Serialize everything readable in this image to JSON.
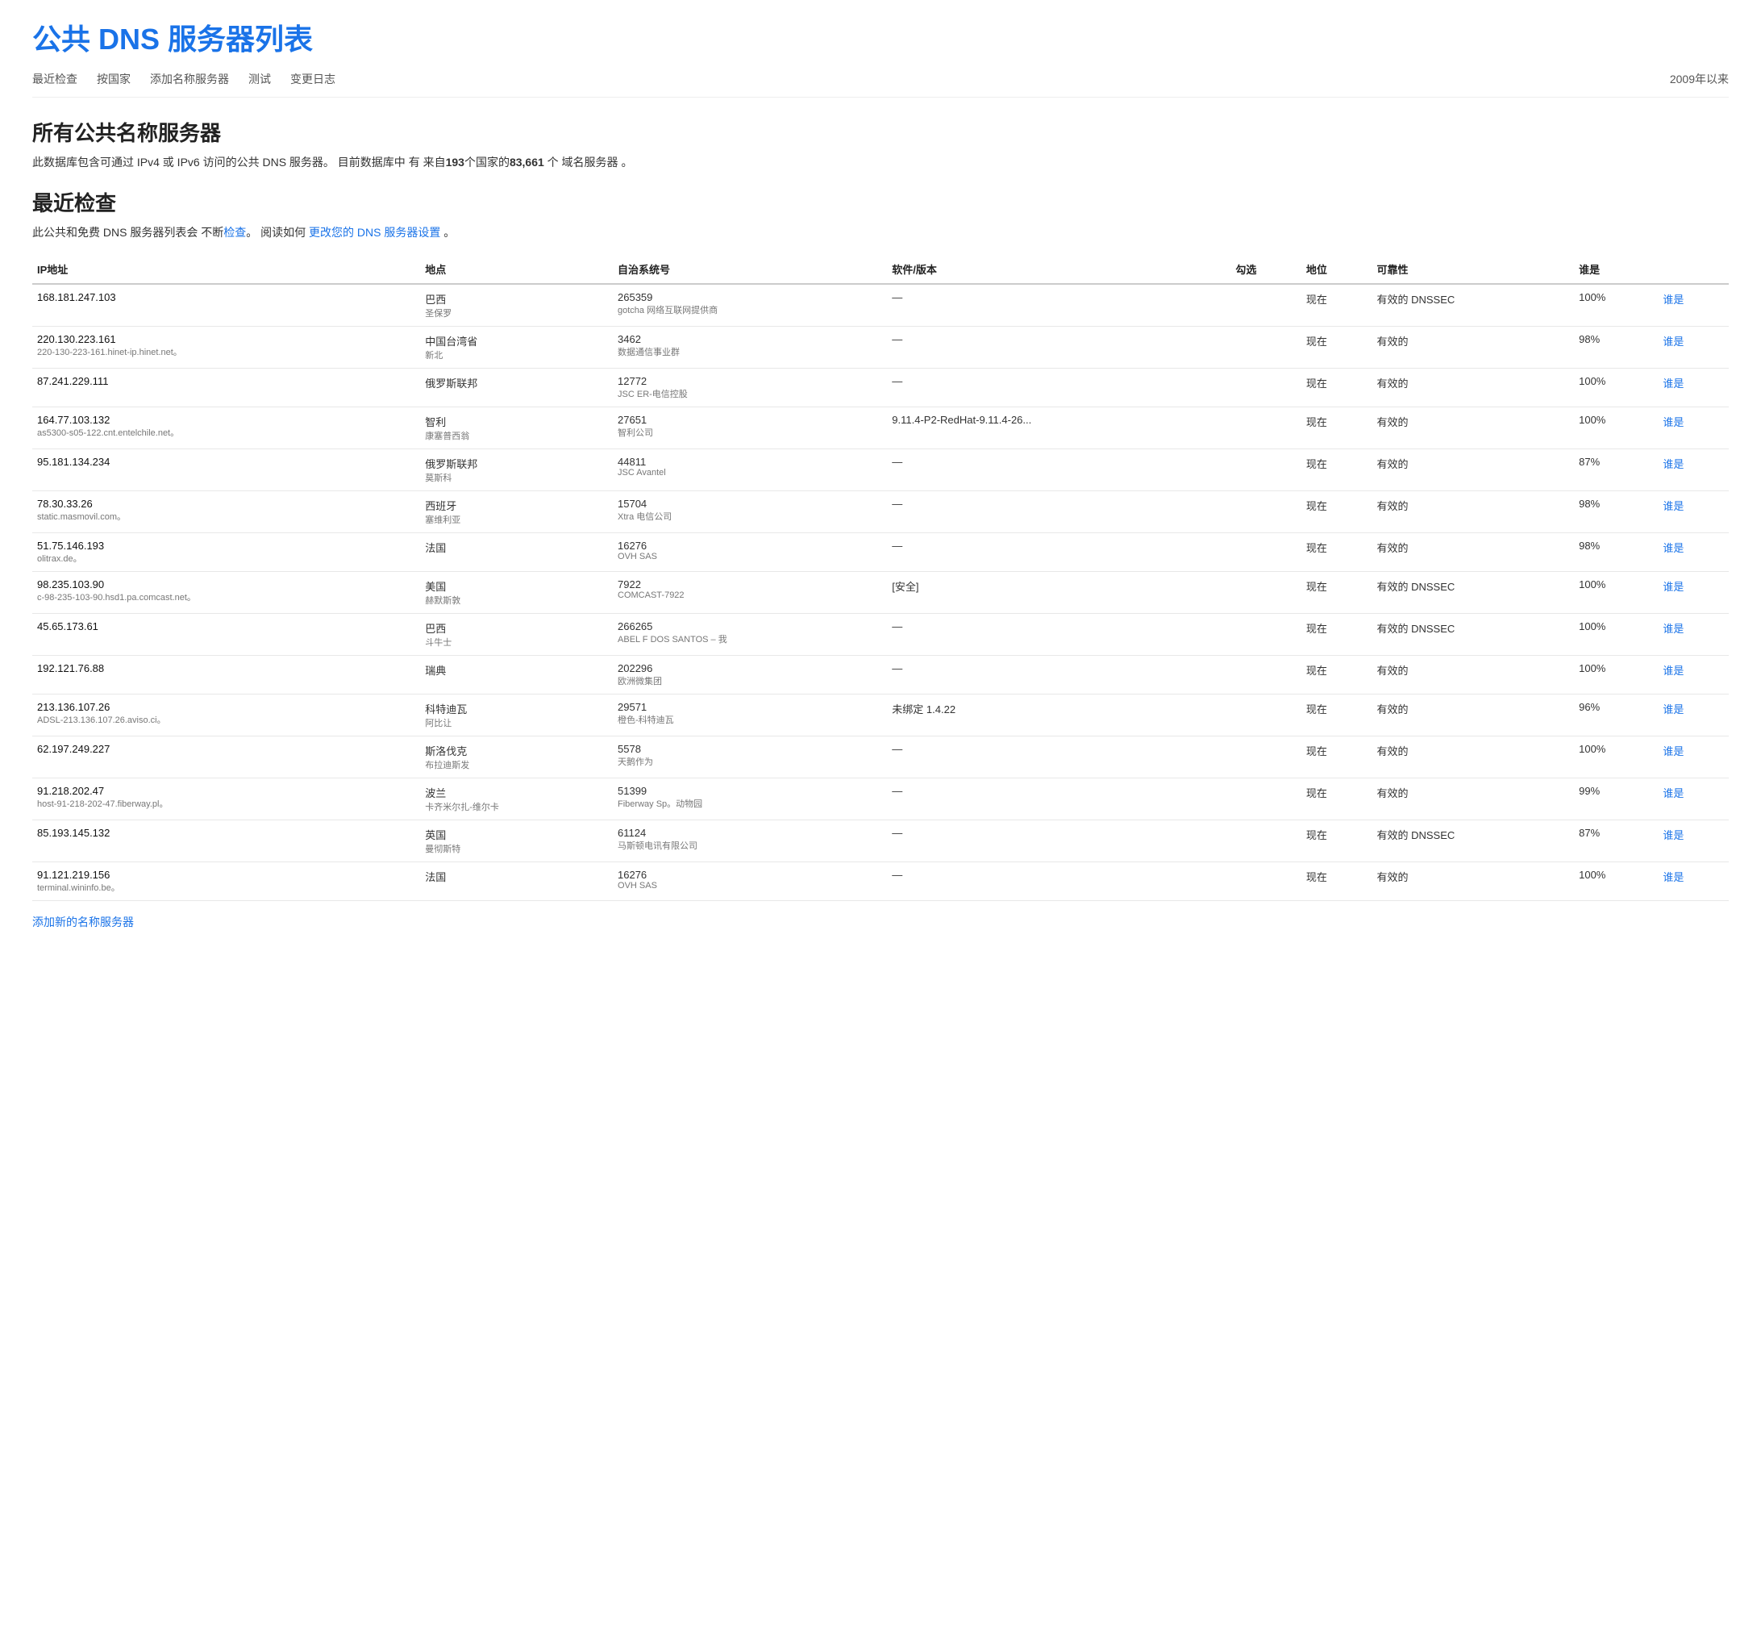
{
  "page": {
    "title": "公共 DNS 服务器列表",
    "year_label": "2009年以来"
  },
  "nav": {
    "links": [
      {
        "label": "最近检查",
        "href": "#"
      },
      {
        "label": "按国家",
        "href": "#"
      },
      {
        "label": "添加名称服务器",
        "href": "#"
      },
      {
        "label": "测试",
        "href": "#"
      },
      {
        "label": "变更日志",
        "href": "#"
      }
    ]
  },
  "all_servers_section": {
    "title": "所有公共名称服务器",
    "description_parts": [
      "此数据库包含可通过 IPv4 或 IPv6 访问的公共 DNS 服务器。 目前数据库中 有 来自",
      "193",
      "个国家的",
      "83,661",
      "个 域名服务器 。"
    ]
  },
  "recent_section": {
    "title": "最近检查",
    "desc_prefix": "此公共和免费 DNS 服务器列表会 不断",
    "desc_check_link": "检查",
    "desc_middle": "。 阅读如何 ",
    "desc_change_link": "更改您的 DNS 服务器设置",
    "desc_suffix": " 。"
  },
  "table": {
    "headers": [
      "IP地址",
      "地点",
      "自治系统号",
      "软件/版本",
      "勾选",
      "地位",
      "可靠性",
      "谁是"
    ],
    "rows": [
      {
        "ip": "168.181.247.103",
        "ip_sub": "",
        "location": "巴西",
        "location_sub": "圣保罗",
        "asn": "265359",
        "asn_sub": "gotcha 网络互联网提供商",
        "software": "—",
        "check": "",
        "status": "现在",
        "validity": "有效的 DNSSEC",
        "reliability": "100%",
        "whois": "谁是"
      },
      {
        "ip": "220.130.223.161",
        "ip_sub": "220-130-223-161.hinet-ip.hinet.net。",
        "location": "中国台湾省",
        "location_sub": "新北",
        "asn": "3462",
        "asn_sub": "数据通信事业群",
        "software": "—",
        "check": "",
        "status": "现在",
        "validity": "有效的",
        "reliability": "98%",
        "whois": "谁是"
      },
      {
        "ip": "87.241.229.111",
        "ip_sub": "",
        "location": "俄罗斯联邦",
        "location_sub": "",
        "asn": "12772",
        "asn_sub": "JSC ER-电信控股",
        "software": "—",
        "check": "",
        "status": "现在",
        "validity": "有效的",
        "reliability": "100%",
        "whois": "谁是"
      },
      {
        "ip": "164.77.103.132",
        "ip_sub": "as5300-s05-122.cnt.entelchile.net。",
        "location": "智利",
        "location_sub": "康塞普西翁",
        "asn": "27651",
        "asn_sub": "智利公司",
        "software": "9.11.4-P2-RedHat-9.11.4-26...",
        "check": "",
        "status": "现在",
        "validity": "有效的",
        "reliability": "100%",
        "whois": "谁是"
      },
      {
        "ip": "95.181.134.234",
        "ip_sub": "",
        "location": "俄罗斯联邦",
        "location_sub": "莫斯科",
        "asn": "44811",
        "asn_sub": "JSC Avantel",
        "software": "—",
        "check": "",
        "status": "现在",
        "validity": "有效的",
        "reliability": "87%",
        "whois": "谁是"
      },
      {
        "ip": "78.30.33.26",
        "ip_sub": "static.masmovil.com。",
        "location": "西班牙",
        "location_sub": "塞维利亚",
        "asn": "15704",
        "asn_sub": "Xtra 电信公司",
        "software": "—",
        "check": "",
        "status": "现在",
        "validity": "有效的",
        "reliability": "98%",
        "whois": "谁是"
      },
      {
        "ip": "51.75.146.193",
        "ip_sub": "olitrax.de。",
        "location": "法国",
        "location_sub": "",
        "asn": "16276",
        "asn_sub": "OVH SAS",
        "software": "—",
        "check": "",
        "status": "现在",
        "validity": "有效的",
        "reliability": "98%",
        "whois": "谁是"
      },
      {
        "ip": "98.235.103.90",
        "ip_sub": "c-98-235-103-90.hsd1.pa.comcast.net。",
        "location": "美国",
        "location_sub": "赫默斯敦",
        "asn": "7922",
        "asn_sub": "COMCAST-7922",
        "software": "[安全]",
        "check": "",
        "status": "现在",
        "validity": "有效的 DNSSEC",
        "reliability": "100%",
        "whois": "谁是"
      },
      {
        "ip": "45.65.173.61",
        "ip_sub": "",
        "location": "巴西",
        "location_sub": "斗牛士",
        "asn": "266265",
        "asn_sub": "ABEL F DOS SANTOS – 我",
        "software": "—",
        "check": "",
        "status": "现在",
        "validity": "有效的 DNSSEC",
        "reliability": "100%",
        "whois": "谁是"
      },
      {
        "ip": "192.121.76.88",
        "ip_sub": "",
        "location": "瑞典",
        "location_sub": "",
        "asn": "202296",
        "asn_sub": "欧洲微集团",
        "software": "—",
        "check": "",
        "status": "现在",
        "validity": "有效的",
        "reliability": "100%",
        "whois": "谁是"
      },
      {
        "ip": "213.136.107.26",
        "ip_sub": "ADSL-213.136.107.26.aviso.ci。",
        "location": "科特迪瓦",
        "location_sub": "阿比让",
        "asn": "29571",
        "asn_sub": "橙色-科特迪瓦",
        "software": "未绑定 1.4.22",
        "check": "",
        "status": "现在",
        "validity": "有效的",
        "reliability": "96%",
        "whois": "谁是"
      },
      {
        "ip": "62.197.249.227",
        "ip_sub": "",
        "location": "斯洛伐克",
        "location_sub": "布拉迪斯发",
        "asn": "5578",
        "asn_sub": "天鹅作为",
        "software": "—",
        "check": "",
        "status": "现在",
        "validity": "有效的",
        "reliability": "100%",
        "whois": "谁是"
      },
      {
        "ip": "91.218.202.47",
        "ip_sub": "host-91-218-202-47.fiberway.pl。",
        "location": "波兰",
        "location_sub": "卡齐米尔扎-维尔卡",
        "asn": "51399",
        "asn_sub": "Fiberway Sp。动物园",
        "software": "—",
        "check": "",
        "status": "现在",
        "validity": "有效的",
        "reliability": "99%",
        "whois": "谁是"
      },
      {
        "ip": "85.193.145.132",
        "ip_sub": "",
        "location": "英国",
        "location_sub": "曼彻斯特",
        "asn": "61124",
        "asn_sub": "马斯顿电讯有限公司",
        "software": "—",
        "check": "",
        "status": "现在",
        "validity": "有效的 DNSSEC",
        "reliability": "87%",
        "whois": "谁是"
      },
      {
        "ip": "91.121.219.156",
        "ip_sub": "terminal.wininfo.be。",
        "location": "法国",
        "location_sub": "",
        "asn": "16276",
        "asn_sub": "OVH SAS",
        "software": "—",
        "check": "",
        "status": "现在",
        "validity": "有效的",
        "reliability": "100%",
        "whois": "谁是"
      }
    ]
  },
  "add_link_label": "添加新的名称服务器",
  "colors": {
    "blue": "#1a73e8",
    "link_blue": "#1a73e8"
  }
}
